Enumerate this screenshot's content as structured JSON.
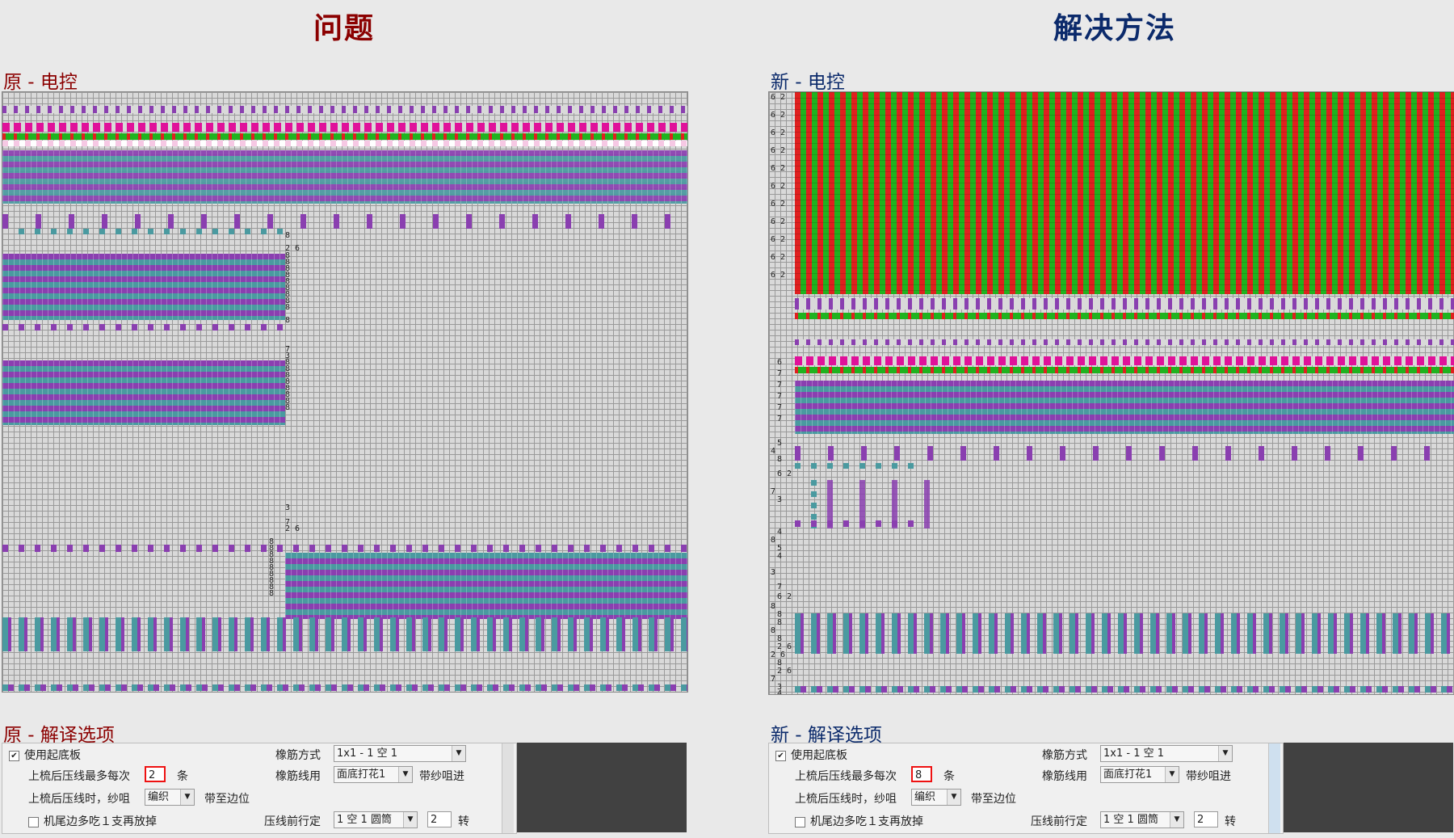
{
  "left": {
    "heading": "问题",
    "grid_label": "原 - 电控",
    "options_label": "原 - 解译选项",
    "numbers": [
      "8",
      "2 6",
      "8",
      "8",
      "8",
      "8",
      "8",
      "8",
      "8",
      "8",
      "8",
      "8",
      "7",
      "3",
      "8",
      "8",
      "8",
      "8",
      "8",
      "8",
      "8",
      "8",
      "3",
      "7",
      "2 6",
      "8",
      "8",
      "8",
      "8",
      "8",
      "8",
      "8",
      "8",
      "8"
    ],
    "options": {
      "use_base_board": "使用起底板",
      "max_lines_label": "上梳后压线最多每次",
      "max_lines_value": "2",
      "max_lines_unit": "条",
      "yarn_label": "上梳后压线时，纱咀",
      "yarn_value": "编织",
      "yarn_suffix": "带至边位",
      "tail_option": "机尾边多吃１支再放掉",
      "rubber_mode_label": "橡筋方式",
      "rubber_mode_value": "1x1 - 1 空 1",
      "rubber_yarn_label": "橡筋线用",
      "rubber_yarn_value": "面底打花1",
      "rubber_yarn_suffix": "带纱咀进",
      "press_label": "压线前行定",
      "press_value": "1 空 1 圆筒",
      "turns_value": "2",
      "turns_unit": "转"
    }
  },
  "right": {
    "heading": "解决方法",
    "grid_label": "新 - 电控",
    "options_label": "新 - 解译选项",
    "numbers": [
      "6 2",
      "6 2",
      "6 2",
      "6 2",
      "6 2",
      "6 2",
      "6 2",
      "6 2",
      "6 2",
      "6 2",
      "6 2",
      "6",
      "7",
      "7",
      "7",
      "7",
      "7",
      "5",
      "4",
      "8",
      "6 2",
      "7",
      "3",
      "4",
      "8",
      "5",
      "4",
      "3",
      "7",
      "6 2",
      "8",
      "8",
      "8",
      "8",
      "8",
      "2 6",
      "2 6",
      "8",
      "2 6",
      "7",
      "3",
      "4",
      "5",
      "5",
      "4",
      "3",
      "7",
      "2 6",
      "8",
      "8"
    ],
    "options": {
      "use_base_board": "使用起底板",
      "max_lines_label": "上梳后压线最多每次",
      "max_lines_value": "8",
      "max_lines_unit": "条",
      "yarn_label": "上梳后压线时，纱咀",
      "yarn_value": "编织",
      "yarn_suffix": "带至边位",
      "tail_option": "机尾边多吃１支再放掉",
      "rubber_mode_label": "橡筋方式",
      "rubber_mode_value": "1x1 - 1 空 1",
      "rubber_yarn_label": "橡筋线用",
      "rubber_yarn_value": "面底打花1",
      "rubber_yarn_suffix": "带纱咀进",
      "press_label": "压线前行定",
      "press_value": "1 空 1 圆筒",
      "turns_value": "2",
      "turns_unit": "转"
    }
  },
  "colors": {
    "problem_title": "#8b0000",
    "solution_title": "#0b2a6b",
    "purple": "#8a3fb0",
    "teal": "#4a9aa0",
    "magenta": "#e0119a",
    "green": "#1fb31f",
    "red": "#e0201f",
    "highlight_box": "#e11111"
  }
}
